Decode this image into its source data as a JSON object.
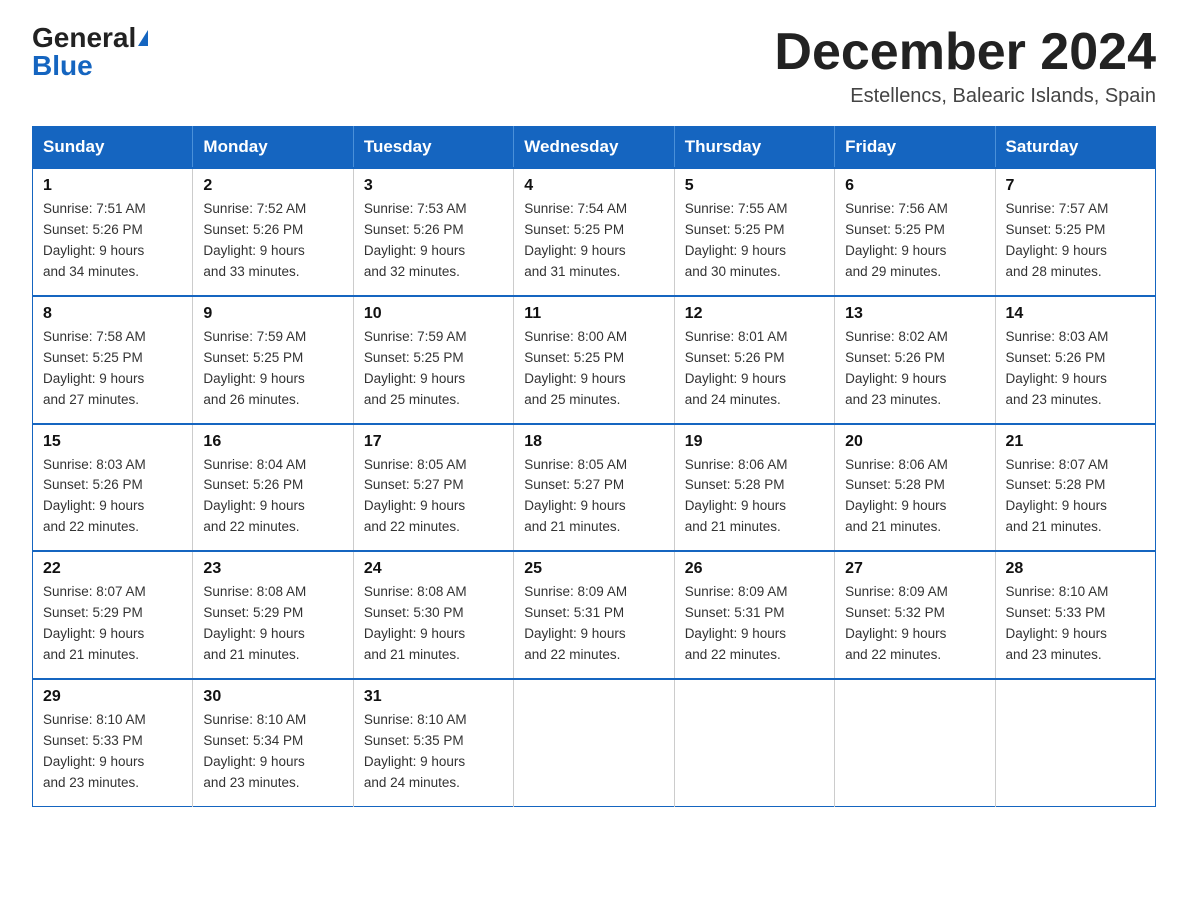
{
  "header": {
    "logo_general": "General",
    "logo_blue": "Blue",
    "main_title": "December 2024",
    "subtitle": "Estellencs, Balearic Islands, Spain"
  },
  "days_of_week": [
    "Sunday",
    "Monday",
    "Tuesday",
    "Wednesday",
    "Thursday",
    "Friday",
    "Saturday"
  ],
  "weeks": [
    [
      {
        "day": "1",
        "sunrise": "7:51 AM",
        "sunset": "5:26 PM",
        "daylight": "9 hours and 34 minutes."
      },
      {
        "day": "2",
        "sunrise": "7:52 AM",
        "sunset": "5:26 PM",
        "daylight": "9 hours and 33 minutes."
      },
      {
        "day": "3",
        "sunrise": "7:53 AM",
        "sunset": "5:26 PM",
        "daylight": "9 hours and 32 minutes."
      },
      {
        "day": "4",
        "sunrise": "7:54 AM",
        "sunset": "5:25 PM",
        "daylight": "9 hours and 31 minutes."
      },
      {
        "day": "5",
        "sunrise": "7:55 AM",
        "sunset": "5:25 PM",
        "daylight": "9 hours and 30 minutes."
      },
      {
        "day": "6",
        "sunrise": "7:56 AM",
        "sunset": "5:25 PM",
        "daylight": "9 hours and 29 minutes."
      },
      {
        "day": "7",
        "sunrise": "7:57 AM",
        "sunset": "5:25 PM",
        "daylight": "9 hours and 28 minutes."
      }
    ],
    [
      {
        "day": "8",
        "sunrise": "7:58 AM",
        "sunset": "5:25 PM",
        "daylight": "9 hours and 27 minutes."
      },
      {
        "day": "9",
        "sunrise": "7:59 AM",
        "sunset": "5:25 PM",
        "daylight": "9 hours and 26 minutes."
      },
      {
        "day": "10",
        "sunrise": "7:59 AM",
        "sunset": "5:25 PM",
        "daylight": "9 hours and 25 minutes."
      },
      {
        "day": "11",
        "sunrise": "8:00 AM",
        "sunset": "5:25 PM",
        "daylight": "9 hours and 25 minutes."
      },
      {
        "day": "12",
        "sunrise": "8:01 AM",
        "sunset": "5:26 PM",
        "daylight": "9 hours and 24 minutes."
      },
      {
        "day": "13",
        "sunrise": "8:02 AM",
        "sunset": "5:26 PM",
        "daylight": "9 hours and 23 minutes."
      },
      {
        "day": "14",
        "sunrise": "8:03 AM",
        "sunset": "5:26 PM",
        "daylight": "9 hours and 23 minutes."
      }
    ],
    [
      {
        "day": "15",
        "sunrise": "8:03 AM",
        "sunset": "5:26 PM",
        "daylight": "9 hours and 22 minutes."
      },
      {
        "day": "16",
        "sunrise": "8:04 AM",
        "sunset": "5:26 PM",
        "daylight": "9 hours and 22 minutes."
      },
      {
        "day": "17",
        "sunrise": "8:05 AM",
        "sunset": "5:27 PM",
        "daylight": "9 hours and 22 minutes."
      },
      {
        "day": "18",
        "sunrise": "8:05 AM",
        "sunset": "5:27 PM",
        "daylight": "9 hours and 21 minutes."
      },
      {
        "day": "19",
        "sunrise": "8:06 AM",
        "sunset": "5:28 PM",
        "daylight": "9 hours and 21 minutes."
      },
      {
        "day": "20",
        "sunrise": "8:06 AM",
        "sunset": "5:28 PM",
        "daylight": "9 hours and 21 minutes."
      },
      {
        "day": "21",
        "sunrise": "8:07 AM",
        "sunset": "5:28 PM",
        "daylight": "9 hours and 21 minutes."
      }
    ],
    [
      {
        "day": "22",
        "sunrise": "8:07 AM",
        "sunset": "5:29 PM",
        "daylight": "9 hours and 21 minutes."
      },
      {
        "day": "23",
        "sunrise": "8:08 AM",
        "sunset": "5:29 PM",
        "daylight": "9 hours and 21 minutes."
      },
      {
        "day": "24",
        "sunrise": "8:08 AM",
        "sunset": "5:30 PM",
        "daylight": "9 hours and 21 minutes."
      },
      {
        "day": "25",
        "sunrise": "8:09 AM",
        "sunset": "5:31 PM",
        "daylight": "9 hours and 22 minutes."
      },
      {
        "day": "26",
        "sunrise": "8:09 AM",
        "sunset": "5:31 PM",
        "daylight": "9 hours and 22 minutes."
      },
      {
        "day": "27",
        "sunrise": "8:09 AM",
        "sunset": "5:32 PM",
        "daylight": "9 hours and 22 minutes."
      },
      {
        "day": "28",
        "sunrise": "8:10 AM",
        "sunset": "5:33 PM",
        "daylight": "9 hours and 23 minutes."
      }
    ],
    [
      {
        "day": "29",
        "sunrise": "8:10 AM",
        "sunset": "5:33 PM",
        "daylight": "9 hours and 23 minutes."
      },
      {
        "day": "30",
        "sunrise": "8:10 AM",
        "sunset": "5:34 PM",
        "daylight": "9 hours and 23 minutes."
      },
      {
        "day": "31",
        "sunrise": "8:10 AM",
        "sunset": "5:35 PM",
        "daylight": "9 hours and 24 minutes."
      },
      null,
      null,
      null,
      null
    ]
  ]
}
